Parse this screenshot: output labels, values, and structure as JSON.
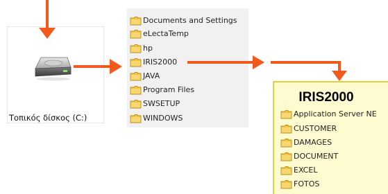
{
  "drive": {
    "label": "Τοπικός δίσκος (C:)",
    "icon": "hard-drive-icon"
  },
  "root_folders": [
    {
      "label": "Documents and Settings"
    },
    {
      "label": "eLectaTemp"
    },
    {
      "label": "hp"
    },
    {
      "label": "IRIS2000"
    },
    {
      "label": "JAVA"
    },
    {
      "label": "Program Files"
    },
    {
      "label": "SWSETUP"
    },
    {
      "label": "WINDOWS"
    }
  ],
  "iris": {
    "title": "IRIS2000",
    "folders": [
      {
        "label": "Application Server NE"
      },
      {
        "label": "CUSTOMER"
      },
      {
        "label": "DAMAGES"
      },
      {
        "label": "DOCUMENT"
      },
      {
        "label": "EXCEL"
      },
      {
        "label": "FOTOS"
      }
    ]
  },
  "colors": {
    "arrow": "#f25a1d",
    "folder": "#f3c548",
    "highlight_bg": "#fffbd0",
    "highlight_border": "#e3cf32"
  }
}
